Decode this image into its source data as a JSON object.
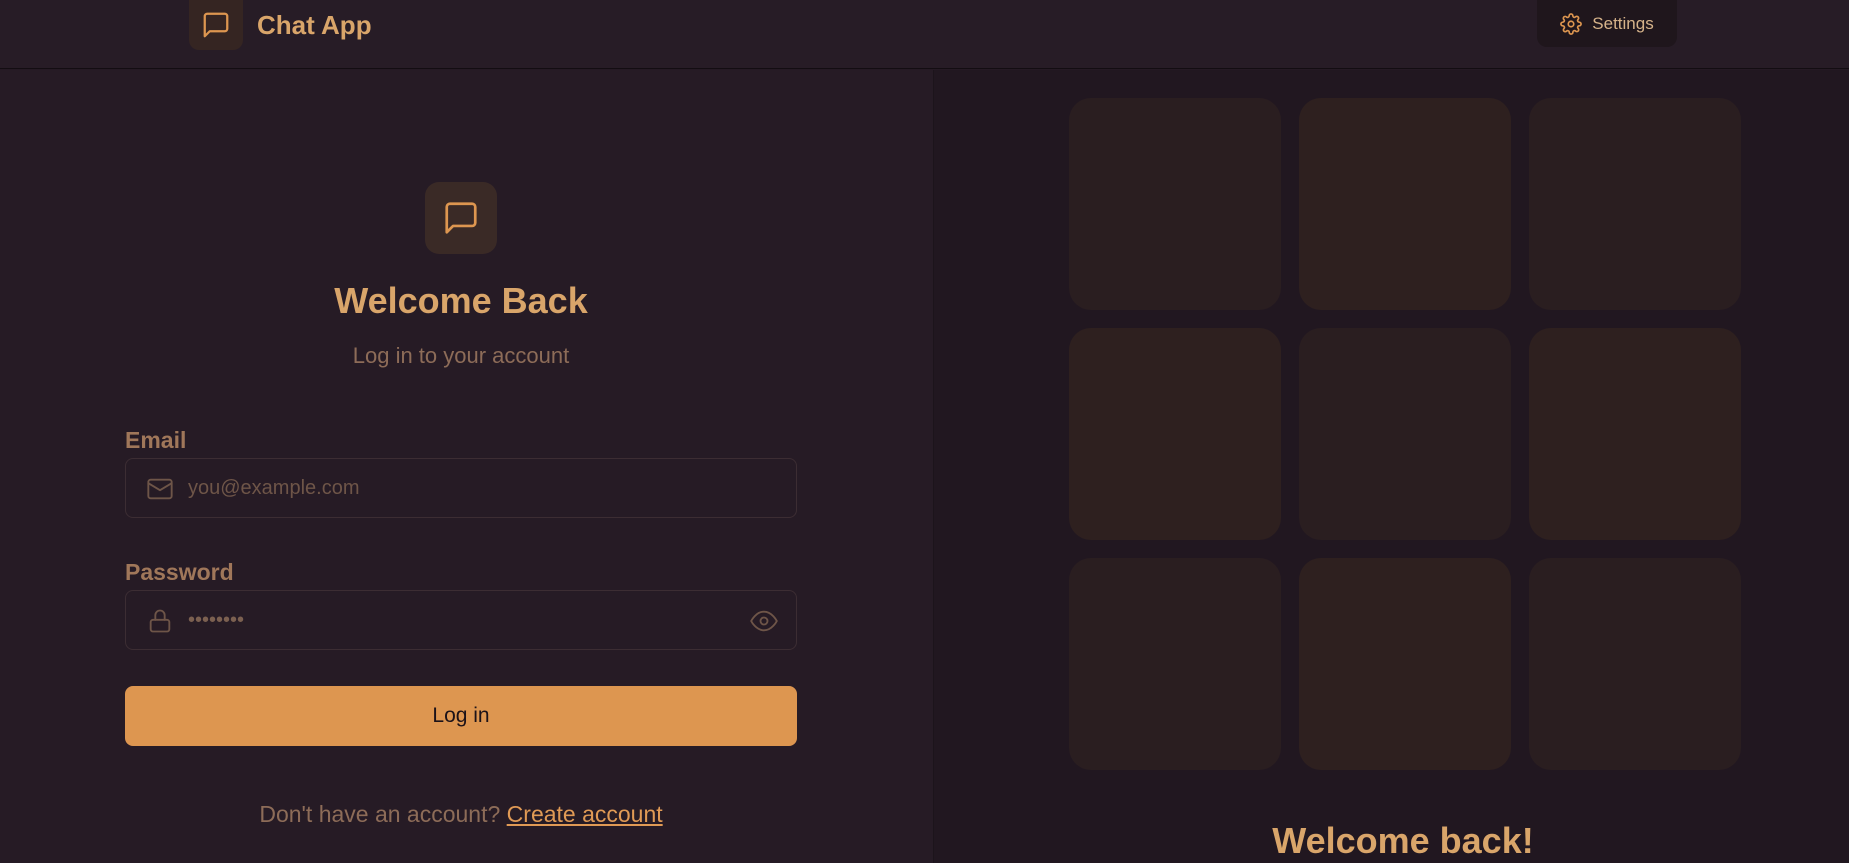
{
  "app": {
    "title": "Chat App",
    "brand_icon": "message-square-icon"
  },
  "header": {
    "settings_label": "Settings",
    "settings_icon": "gear-icon"
  },
  "login": {
    "logo_icon": "message-square-icon",
    "title": "Welcome Back",
    "subtitle": "Log in to your account",
    "email": {
      "label": "Email",
      "placeholder": "you@example.com",
      "value": "",
      "icon": "mail-icon"
    },
    "password": {
      "label": "Password",
      "value": "••••••••",
      "icon": "lock-icon",
      "toggle_icon": "eye-icon"
    },
    "submit_label": "Log in",
    "signup_prompt": "Don't have an account? ",
    "signup_link": "Create account"
  },
  "pattern": {
    "title": "Welcome back!"
  },
  "colors": {
    "accent": "#dd9650",
    "heading": "#d9a56a",
    "muted": "#8d6c58",
    "background": "#251a24"
  }
}
